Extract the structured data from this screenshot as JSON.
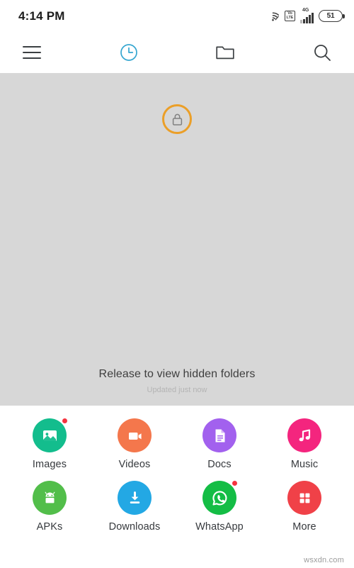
{
  "statusbar": {
    "time": "4:14 PM",
    "wifi_icon": "wifi-icon",
    "volte_top": "Vo",
    "volte_bottom": "LTE",
    "network_type": "4G",
    "signal_icon": "signal-bars-icon",
    "battery_level": "51"
  },
  "toolbar": {
    "menu_icon": "hamburger-menu-icon",
    "recent_icon": "clock-recent-icon",
    "folder_icon": "folder-icon",
    "search_icon": "search-icon",
    "active_tab": "recent",
    "accent_color": "#35a6d0"
  },
  "hidden_panel": {
    "lock_icon": "padlock-icon",
    "lock_ring_color": "#eb9f28",
    "release_text": "Release to view hidden folders",
    "updated_text": "Updated just now",
    "background_color": "#d7d7d7"
  },
  "categories": {
    "rows": [
      [
        {
          "label": "Images",
          "icon": "image-icon",
          "color": "#13bd8d",
          "badge": true
        },
        {
          "label": "Videos",
          "icon": "video-camera-icon",
          "color": "#f4774c",
          "badge": false
        },
        {
          "label": "Docs",
          "icon": "document-icon",
          "color": "#a261ee",
          "badge": false
        },
        {
          "label": "Music",
          "icon": "music-note-icon",
          "color": "#f4257e",
          "badge": false
        }
      ],
      [
        {
          "label": "APKs",
          "icon": "android-robot-icon",
          "color": "#52be4a",
          "badge": false
        },
        {
          "label": "Downloads",
          "icon": "download-arrow-icon",
          "color": "#23a8e4",
          "badge": false
        },
        {
          "label": "WhatsApp",
          "icon": "whatsapp-icon",
          "color": "#14bd45",
          "badge": true
        },
        {
          "label": "More",
          "icon": "grid-squares-icon",
          "color": "#f04148",
          "badge": false
        }
      ]
    ]
  },
  "watermark": {
    "text": "wsxdn.com"
  }
}
